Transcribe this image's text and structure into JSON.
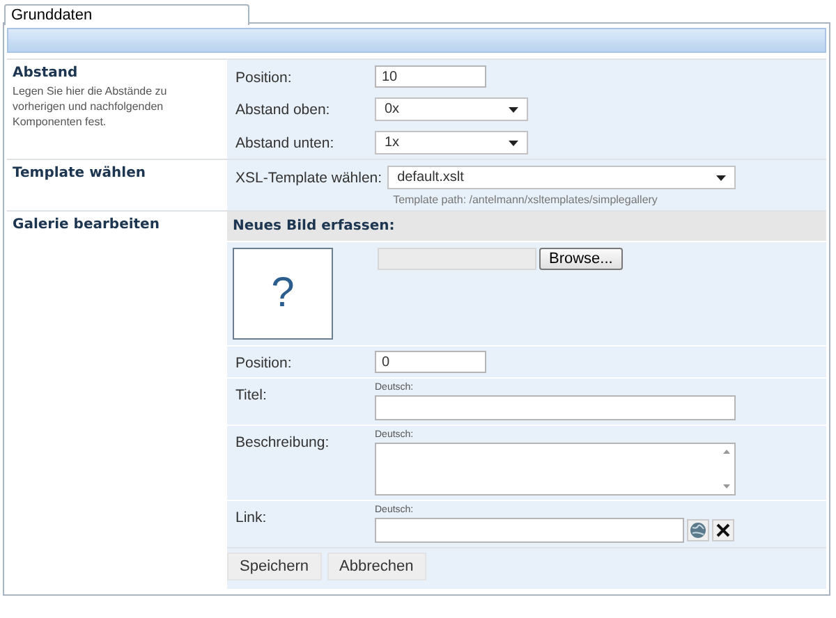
{
  "tabs": [
    {
      "label": "Grunddaten",
      "selected": true
    }
  ],
  "sections": [
    {
      "title": "Abstand",
      "description": "Legen Sie hier die Abstände zu vorherigen und nachfolgenden Komponenten fest.",
      "rows": [
        {
          "kind": "input",
          "label": "Position:",
          "value": "10"
        },
        {
          "kind": "select",
          "label": "Abstand oben:",
          "value": "0x"
        },
        {
          "kind": "select",
          "label": "Abstand unten:",
          "value": "1x"
        }
      ]
    },
    {
      "title": "Template wählen",
      "rows": [
        {
          "kind": "wideselect",
          "label": "XSL-Template wählen:",
          "value": "default.xslt",
          "hint": "Template path: /antelmann/xsltemplates/simplegallery"
        }
      ]
    },
    {
      "title": "Galerie bearbeiten",
      "subheader": "Neues Bild erfassen:",
      "image_placeholder": "?",
      "browse_button": "Browse...",
      "rows": [
        {
          "kind": "input",
          "label": "Position:",
          "value": "0"
        },
        {
          "kind": "text",
          "label": "Titel:",
          "language": "Deutsch:"
        },
        {
          "kind": "textarea",
          "label": "Beschreibung:",
          "language": "Deutsch:"
        },
        {
          "kind": "link",
          "label": "Link:",
          "language": "Deutsch:"
        }
      ],
      "buttons": [
        "Speichern",
        "Abbrechen"
      ]
    }
  ]
}
